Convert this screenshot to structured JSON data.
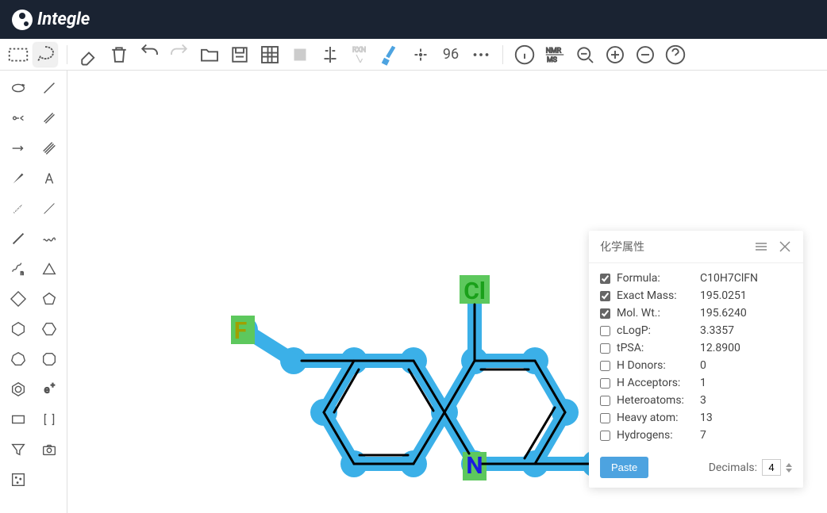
{
  "logo": {
    "text": "Integle"
  },
  "top_toolbar": {
    "text_96": "96"
  },
  "panel": {
    "title": "化学属性",
    "paste_label": "Paste",
    "decimals_label": "Decimals:",
    "decimals_value": "4",
    "properties": [
      {
        "label": "Formula:",
        "value": "C10H7ClFN",
        "checked": true
      },
      {
        "label": "Exact Mass:",
        "value": "195.0251",
        "checked": true
      },
      {
        "label": "Mol. Wt.:",
        "value": "195.6240",
        "checked": true
      },
      {
        "label": "cLogP:",
        "value": "3.3357",
        "checked": false
      },
      {
        "label": "tPSA:",
        "value": "12.8900",
        "checked": false
      },
      {
        "label": "H Donors:",
        "value": "0",
        "checked": false
      },
      {
        "label": "H Acceptors:",
        "value": "1",
        "checked": false
      },
      {
        "label": "Heteroatoms:",
        "value": "3",
        "checked": false
      },
      {
        "label": "Heavy atom:",
        "value": "13",
        "checked": false
      },
      {
        "label": "Hydrogens:",
        "value": "7",
        "checked": false
      }
    ]
  },
  "molecule": {
    "atoms": {
      "Cl": "Cl",
      "F": "F",
      "N": "N"
    }
  }
}
